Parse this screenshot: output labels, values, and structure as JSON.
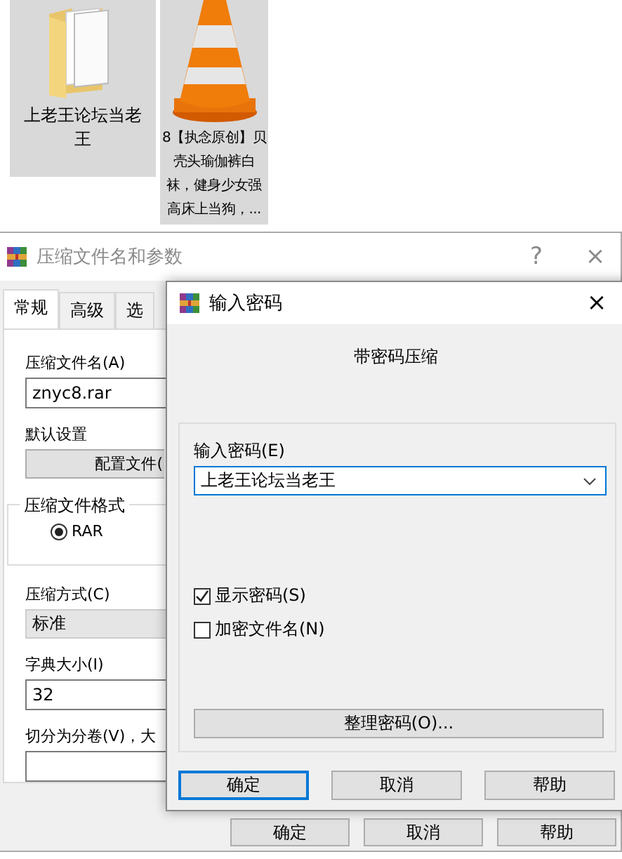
{
  "desktop_icons": [
    {
      "kind": "folder",
      "label_lines": [
        "上老王论坛当老",
        "王"
      ]
    },
    {
      "kind": "video",
      "label_lines": [
        "8【执念原创】贝",
        "壳头瑜伽裤白",
        "袜，健身少女强",
        "高床上当狗，..."
      ]
    }
  ],
  "archive_dialog": {
    "title": "压缩文件名和参数",
    "help": "?",
    "close": "×",
    "tabs": [
      {
        "label": "常规",
        "selected": true
      },
      {
        "label": "高级",
        "selected": false
      },
      {
        "label": "选",
        "selected": false
      }
    ],
    "archive_name": {
      "label": "压缩文件名(A)",
      "value": "znyc8.rar"
    },
    "defaults": {
      "label": "默认设置",
      "button": "配置文件("
    },
    "format": {
      "legend": "压缩文件格式",
      "options": [
        {
          "label": "RAR",
          "selected": true
        }
      ]
    },
    "method": {
      "label": "压缩方式(C)",
      "value": "标准"
    },
    "dictionary": {
      "label": "字典大小(I)",
      "value": "32"
    },
    "split": {
      "label": "切分为分卷(V)，大"
    },
    "buttons": [
      "确定",
      "取消",
      "帮助"
    ]
  },
  "password_dialog": {
    "title": "输入密码",
    "close": "×",
    "heading": "带密码压缩",
    "password": {
      "label": "输入密码(E)",
      "value": "上老王论坛当老王"
    },
    "options": [
      {
        "label": "显示密码(S)",
        "checked": true
      },
      {
        "label": "加密文件名(N)",
        "checked": false
      }
    ],
    "organize_button": "整理密码(O)...",
    "buttons": [
      {
        "label": "确定",
        "default": true
      },
      {
        "label": "取消",
        "default": false
      },
      {
        "label": "帮助",
        "default": false
      }
    ]
  }
}
